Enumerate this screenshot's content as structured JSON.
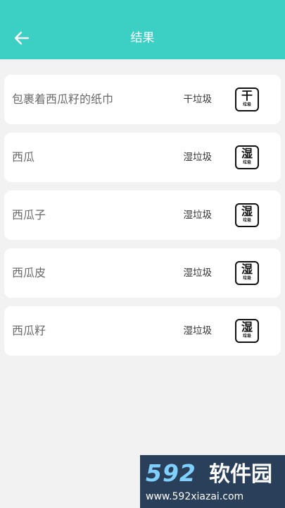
{
  "header": {
    "title": "结果"
  },
  "results": [
    {
      "name": "包裹着西瓜籽的纸巾",
      "category": "干垃圾",
      "badge_main": "干",
      "badge_sub": "垃圾"
    },
    {
      "name": "西瓜",
      "category": "湿垃圾",
      "badge_main": "湿",
      "badge_sub": "垃圾"
    },
    {
      "name": "西瓜子",
      "category": "湿垃圾",
      "badge_main": "湿",
      "badge_sub": "垃圾"
    },
    {
      "name": "西瓜皮",
      "category": "湿垃圾",
      "badge_main": "湿",
      "badge_sub": "垃圾"
    },
    {
      "name": "西瓜籽",
      "category": "湿垃圾",
      "badge_main": "湿",
      "badge_sub": "垃圾"
    }
  ],
  "watermark": {
    "logo": "592",
    "text": "软件园",
    "url": "www.592xiazai.com"
  },
  "colors": {
    "header": "#3ccfc4",
    "background": "#f2f2f2"
  },
  "icons": {
    "back": "arrow-left-icon"
  }
}
